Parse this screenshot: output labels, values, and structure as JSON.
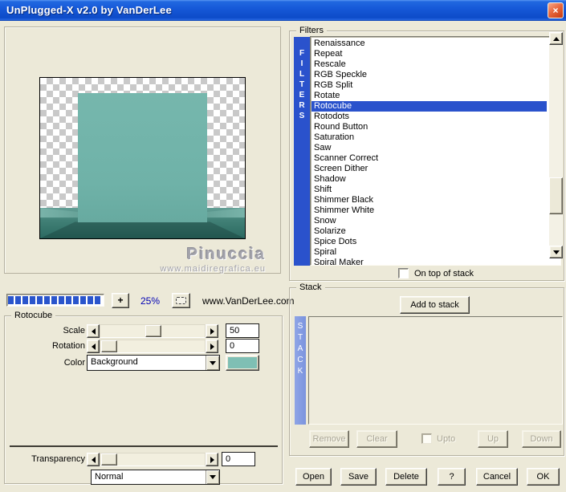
{
  "window": {
    "title": "UnPlugged-X v2.0 by VanDerLee",
    "close_glyph": "×"
  },
  "preview": {
    "watermark_title": "Pinuccia",
    "watermark_url": "www.maidiregrafica.eu"
  },
  "toolbar": {
    "progress_segments": 13,
    "plus_label": "+",
    "zoom_value": "25%",
    "site_label": "www.VanDerLee.com"
  },
  "rotocube": {
    "label": "Rotocube",
    "scale_label": "Scale",
    "scale_value": "50",
    "rotation_label": "Rotation",
    "rotation_value": "0",
    "color_label": "Color",
    "color_value": "Background",
    "swatch_color": "#7fbfb4",
    "transparency_label": "Transparency",
    "transparency_value": "0",
    "blend_value": "Normal"
  },
  "filters": {
    "label": "Filters",
    "strip_text": "FILTERS",
    "selected_item": "Rotocube",
    "items": [
      "Renaissance",
      "Repeat",
      "Rescale",
      "RGB Speckle",
      "RGB Split",
      "Rotate",
      "Rotocube",
      "Rotodots",
      "Round Button",
      "Saturation",
      "Saw",
      "Scanner Correct",
      "Screen Dither",
      "Shadow",
      "Shift",
      "Shimmer Black",
      "Shimmer White",
      "Snow",
      "Solarize",
      "Spice Dots",
      "Spiral",
      "Spiral Maker"
    ],
    "on_top_label": "On top of stack"
  },
  "stack": {
    "label": "Stack",
    "add_button": "Add to stack",
    "strip_text": "STACK",
    "remove_button": "Remove",
    "clear_button": "Clear",
    "upto_label": "Upto",
    "up_button": "Up",
    "down_button": "Down"
  },
  "footer": {
    "open": "Open",
    "save": "Save",
    "delete": "Delete",
    "help": "?",
    "cancel": "Cancel",
    "ok": "OK"
  },
  "colors": {
    "selection_blue": "#2a52cc",
    "titlebar_blue": "#1659d8",
    "stack_strip_blue": "#7b94de",
    "cube_face_teal": "#6fb2a8",
    "floor_teal_dark": "#2c6a61",
    "swatch_teal": "#7fbfb4",
    "progress_segment_blue": "#2a55cc"
  }
}
